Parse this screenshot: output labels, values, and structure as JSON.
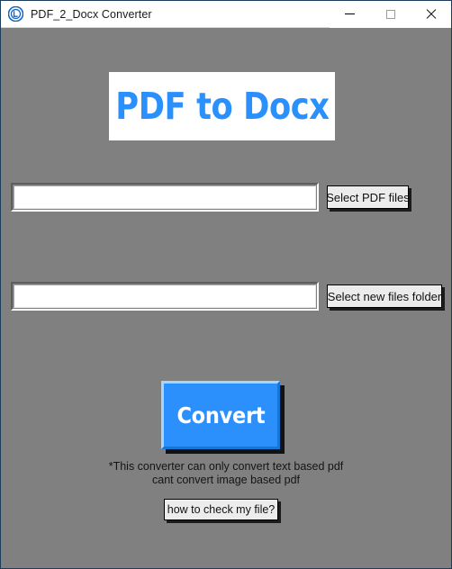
{
  "window": {
    "title": "PDF_2_Docx Converter",
    "icon": "app-logo-icon",
    "background_color": "#808080",
    "titlebar_color": "#ffffff",
    "border_color": "#1b3d5e"
  },
  "window_controls": {
    "minimize": {
      "name": "minimize-button",
      "glyph": "—"
    },
    "maximize": {
      "name": "maximize-button",
      "glyph": "□"
    },
    "close": {
      "name": "close-button",
      "glyph": "×"
    }
  },
  "banner": {
    "text": "PDF to Docx",
    "text_color": "#2a90fb",
    "background_color": "#ffffff"
  },
  "fields": {
    "pdf_path": {
      "label": "pdf-path-input",
      "value": "",
      "placeholder": ""
    },
    "output_folder": {
      "label": "output-folder-input",
      "value": "",
      "placeholder": ""
    }
  },
  "buttons": {
    "select_pdf": "Select PDF files",
    "select_folder": "Select new files folder",
    "convert": "Convert",
    "how_to_check": "how to check my file?"
  },
  "convert_button_colors": {
    "face": "#2b90fb",
    "highlight": "#a8d3fb",
    "shadow": "#1676d8",
    "text": "#ffffff"
  },
  "note": {
    "line1": "*This converter can only convert text based pdf",
    "line2": "cant convert image based pdf"
  }
}
